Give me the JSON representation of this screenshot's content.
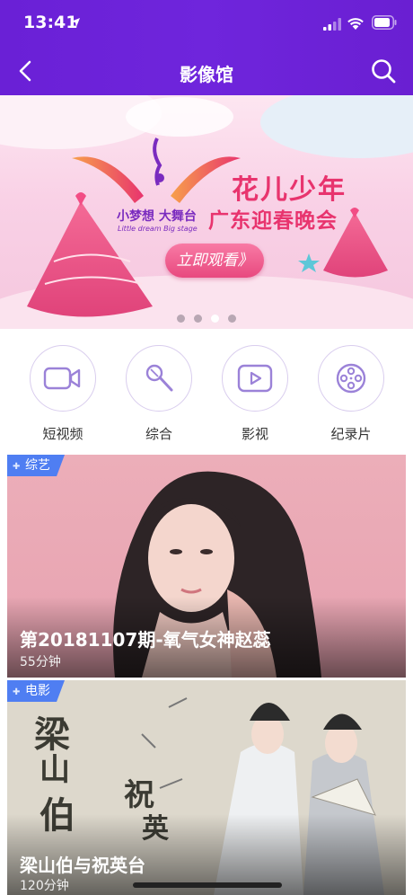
{
  "status_bar": {
    "time": "13:41"
  },
  "header": {
    "title": "影像馆"
  },
  "banner": {
    "title": "花儿少年",
    "subtitle": "广东迎春晚会",
    "logo_cn": "小梦想 大舞台",
    "logo_en": "Little dream Big stage",
    "button_label": "立即观看》",
    "dots_count": 4,
    "active_dot": 3
  },
  "categories": [
    {
      "label": "短视频",
      "icon": "video-camera-icon"
    },
    {
      "label": "综合",
      "icon": "microphone-icon"
    },
    {
      "label": "影视",
      "icon": "play-icon"
    },
    {
      "label": "纪录片",
      "icon": "film-reel-icon"
    }
  ],
  "cards": [
    {
      "tag": "综艺",
      "title": "第20181107期-氧气女神赵蕊",
      "duration": "55分钟"
    },
    {
      "tag": "电影",
      "title": "梁山伯与祝英台",
      "duration": "120分钟"
    }
  ],
  "colors": {
    "header": "#6a20d6",
    "accent": "#e8346e",
    "tag": "#4f7ef2"
  }
}
